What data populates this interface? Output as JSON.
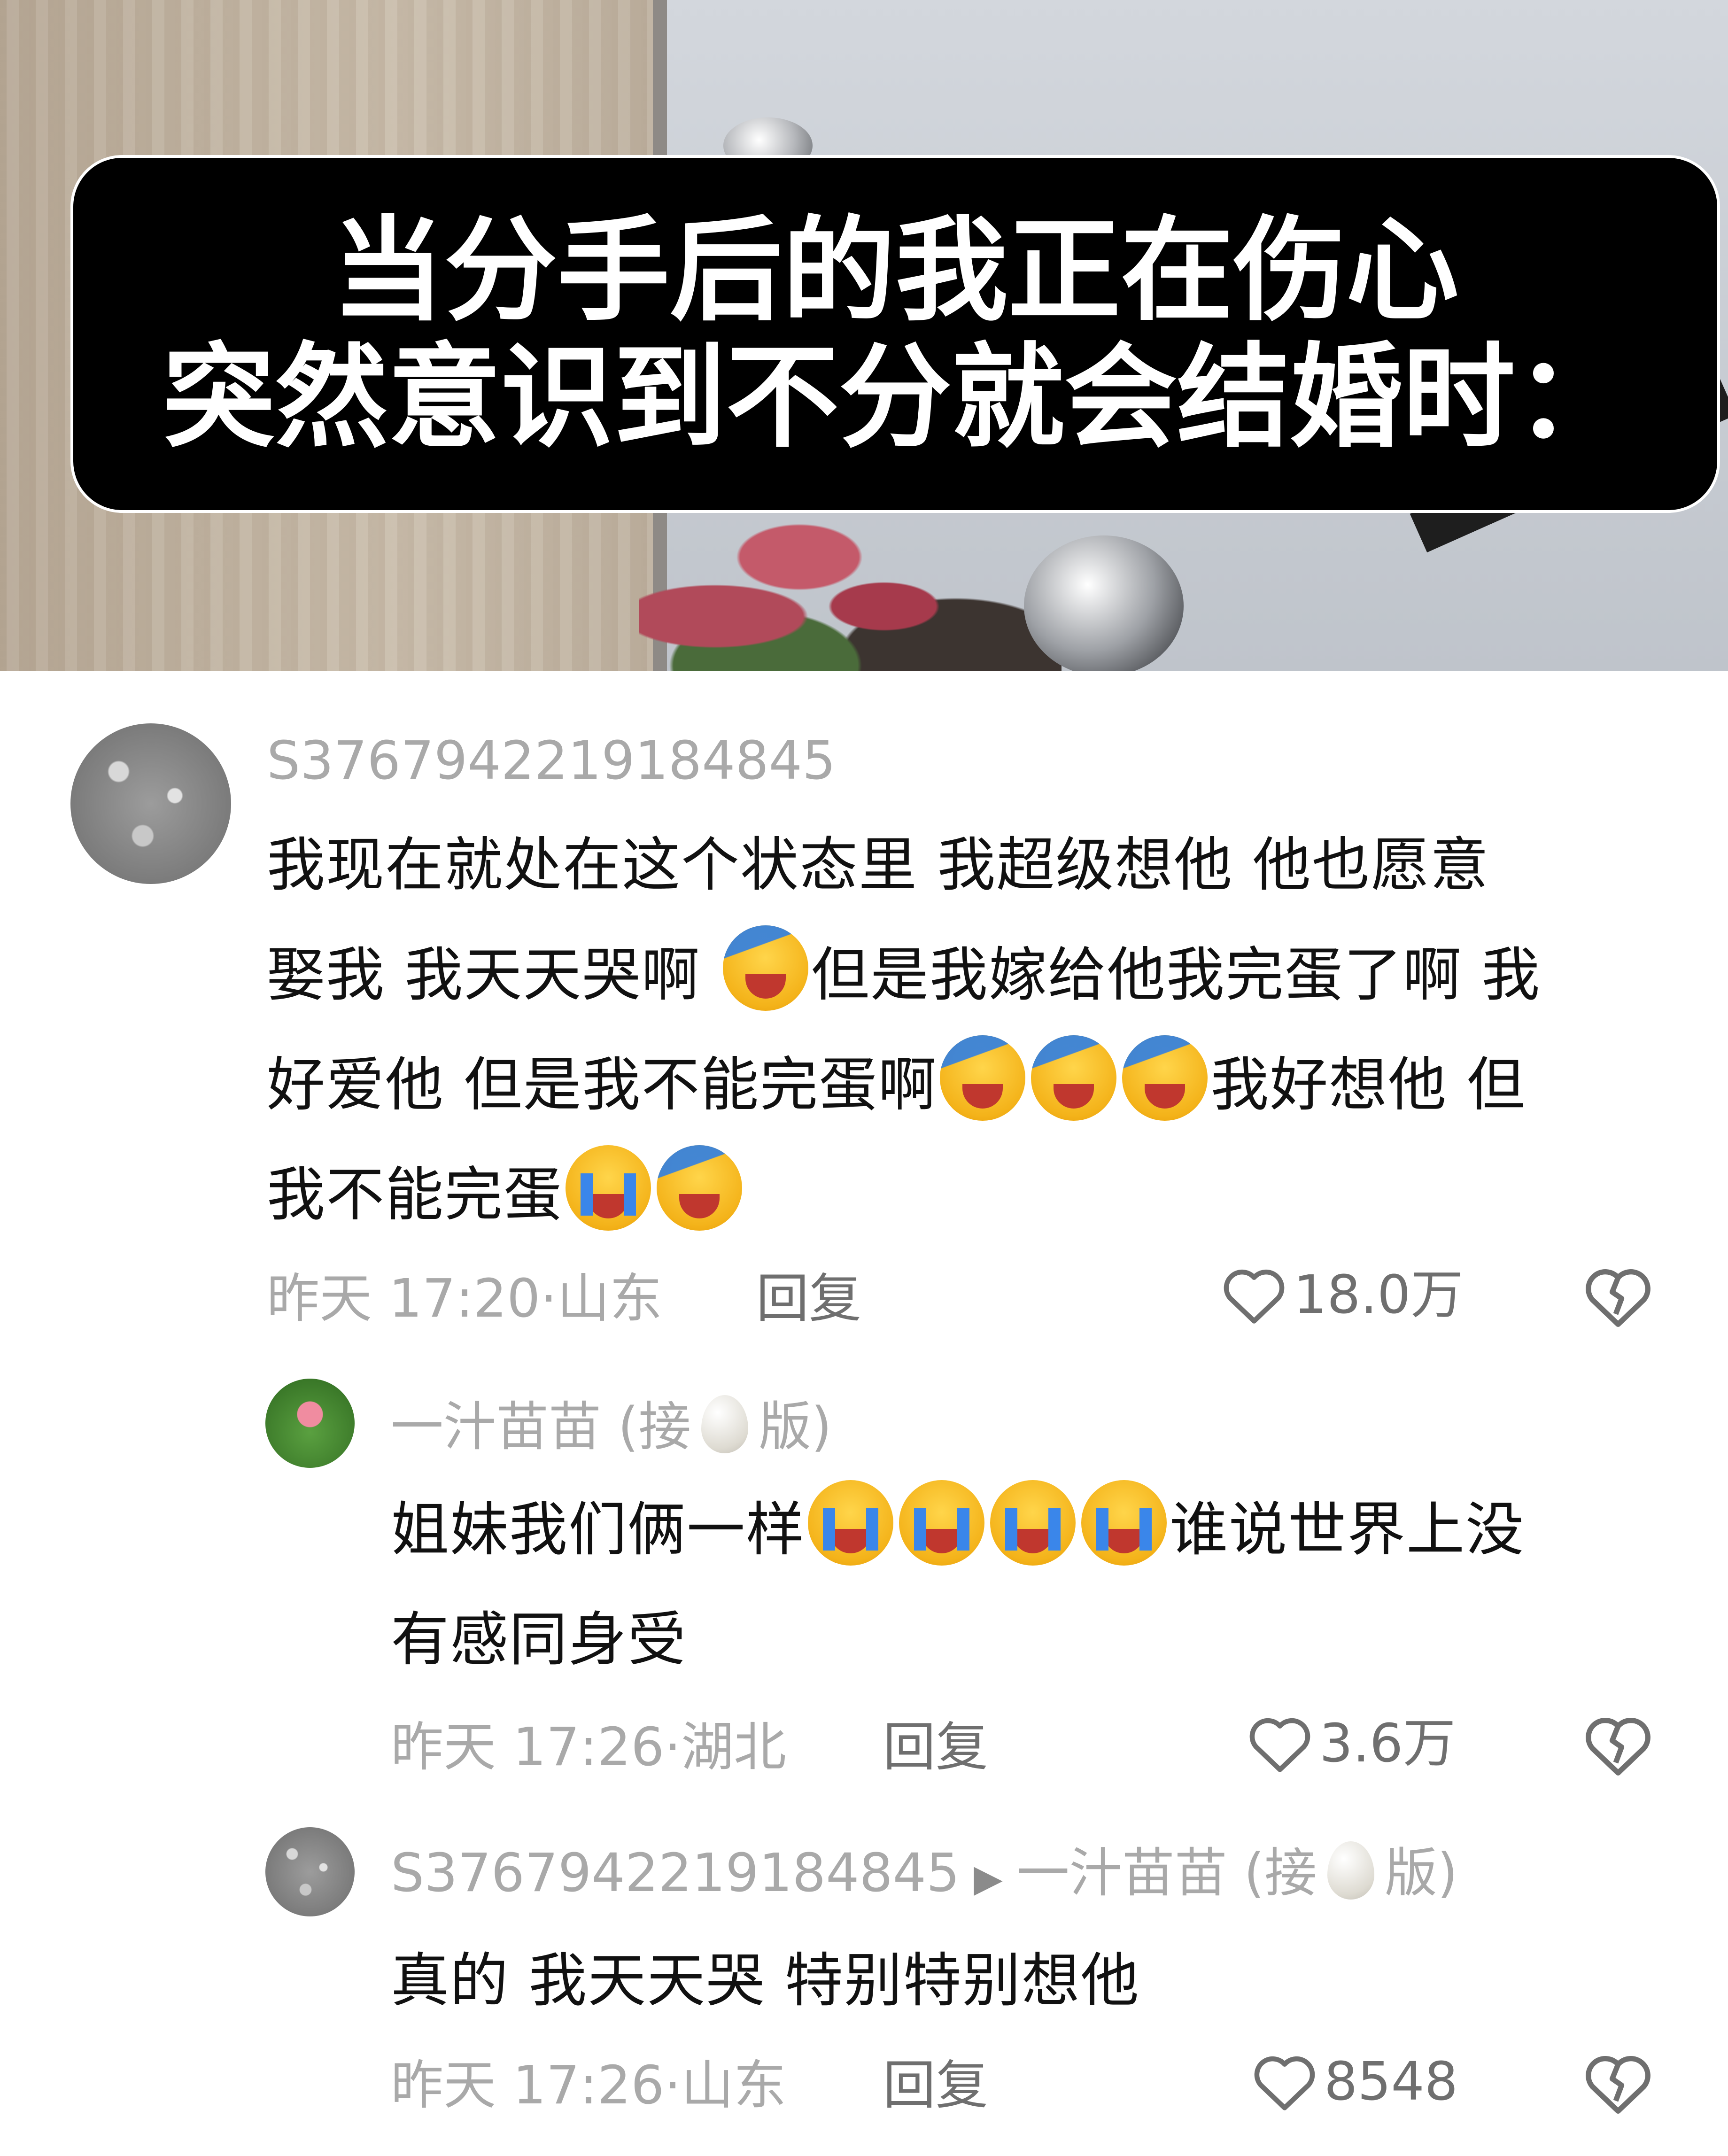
{
  "video": {
    "caption_line1": "当分手后的我正在伤心",
    "caption_line2": "突然意识到不分就会结婚时："
  },
  "comments": [
    {
      "username": "S3767942219184845",
      "text_lines": [
        "我现在就处在这个状态里 我超级想他 他也愿意",
        "娶我 我天天哭啊",
        "但是我嫁给他我完蛋了啊 我",
        "好爱他 但是我不能完蛋啊",
        "我好想他 但",
        "我不能完蛋"
      ],
      "timestamp": "昨天 17:20",
      "location": "山东",
      "reply_label": "回复",
      "likes": "18.0万"
    },
    {
      "username": "一汁苗苗 (接",
      "username_suffix": "版)",
      "text_lines": [
        "姐妹我们俩一样",
        "谁说世界上没",
        "有感同身受"
      ],
      "timestamp": "昨天 17:26",
      "location": "湖北",
      "reply_label": "回复",
      "likes": "3.6万"
    },
    {
      "username": "S3767942219184845",
      "reply_to": "一汁苗苗 (接",
      "reply_to_suffix": "版)",
      "text_lines": [
        "真的 我天天哭 特别特别想他"
      ],
      "timestamp": "昨天 17:26",
      "location": "山东",
      "reply_label": "回复",
      "likes": "8548"
    }
  ],
  "icons": {
    "emoji_cry": "loudly-crying-face",
    "emoji_wail": "crying-face-hand",
    "like": "heart-icon",
    "dislike": "broken-heart-icon"
  },
  "colors": {
    "meta_gray": "#a9a9a9",
    "body_text": "#111111",
    "caption_bg": "#000000"
  }
}
